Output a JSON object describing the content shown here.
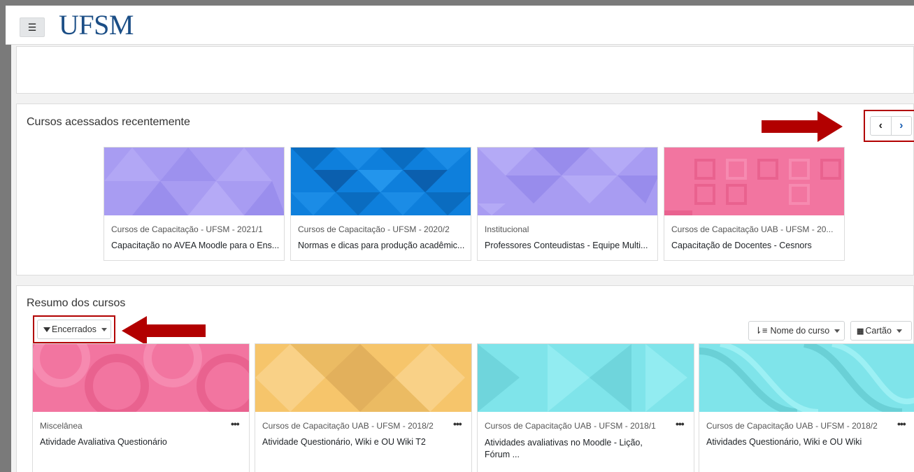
{
  "header": {
    "menu_icon": "☰",
    "logo_text": "UFSM"
  },
  "recent": {
    "title": "Cursos acessados recentemente",
    "prev_icon": "‹",
    "next_icon": "›",
    "courses": [
      {
        "category": "Cursos de Capacitação - UFSM - 2021/1",
        "name": "Capacitação no AVEA Moodle para o Ens...",
        "color": "#a89cf2"
      },
      {
        "category": "Cursos de Capacitação - UFSM - 2020/2",
        "name": "Normas e dicas para produção acadêmic...",
        "color": "#0e7fdc"
      },
      {
        "category": "Institucional",
        "name": "Professores Conteudistas - Equipe Multi...",
        "color": "#a89cf2"
      },
      {
        "category": "Cursos de Capacitação UAB - UFSM - 20...",
        "name": "Capacitação de Docentes - Cesnors",
        "color": "#f275a0"
      }
    ]
  },
  "overview": {
    "title": "Resumo dos cursos",
    "filter_label": "Encerrados",
    "sort_label": "Nome do curso",
    "view_label": "Cartão",
    "courses": [
      {
        "category": "Miscelânea",
        "name": "Atividade Avaliativa Questionário",
        "more": "•••",
        "color": "#f275a0"
      },
      {
        "category": "Cursos de Capacitação UAB - UFSM - 2018/2",
        "name": "Atividade Questionário, Wiki e OU Wiki T2",
        "more": "•••",
        "color": "#f6c56b"
      },
      {
        "category": "Cursos de Capacitação UAB - UFSM - 2018/1",
        "name": "Atividades avaliativas no Moodle - Lição, Fórum ...",
        "more": "•••",
        "color": "#7fe4ea"
      },
      {
        "category": "Cursos de Capacitação UAB - UFSM - 2018/2",
        "name": "Atividades Questionário, Wiki e OU Wiki",
        "more": "•••",
        "color": "#7fe4ea"
      }
    ]
  },
  "colors": {
    "annotation_red": "#b20000",
    "brand_blue": "#1b4e86",
    "link_blue": "#1a5fb4"
  }
}
